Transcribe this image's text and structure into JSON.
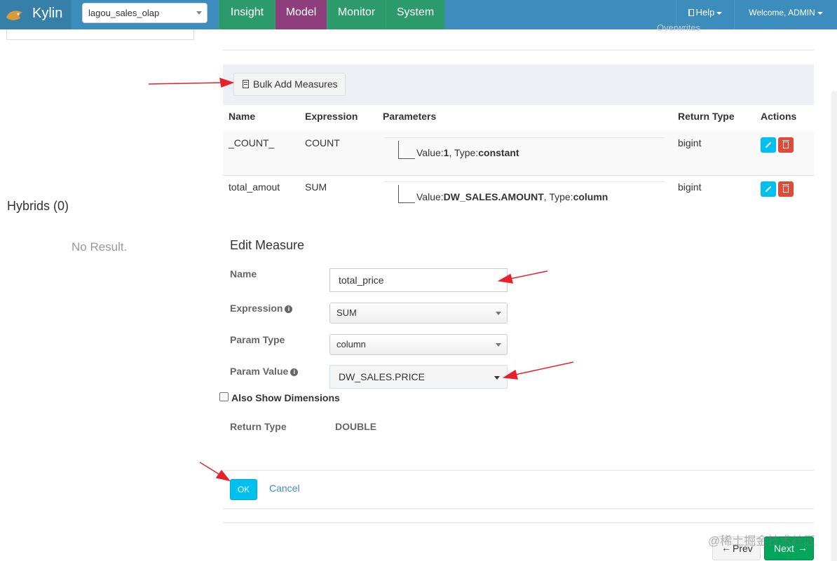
{
  "navbar": {
    "brand": "Kylin",
    "project": "lagou_sales_olap",
    "menu": [
      "Insight",
      "Model",
      "Monitor",
      "System"
    ],
    "active": "Model",
    "help": "Help",
    "welcome": "Welcome, ADMIN"
  },
  "left": {
    "hybrids_title": "Hybrids (0)",
    "no_result": "No Result."
  },
  "top_ghost_text": "Overwrites",
  "measures": {
    "bulk_add_label": "Bulk Add Measures",
    "columns": [
      "Name",
      "Expression",
      "Parameters",
      "Return Type",
      "Actions"
    ],
    "rows": [
      {
        "name": "_COUNT_",
        "expression": "COUNT",
        "param_value": "1",
        "param_type": "constant",
        "return_type": "bigint"
      },
      {
        "name": "total_amout",
        "expression": "SUM",
        "param_value": "DW_SALES.AMOUNT",
        "param_type": "column",
        "return_type": "bigint"
      }
    ],
    "value_prefix": "Value:",
    "type_prefix": ", Type:"
  },
  "edit": {
    "title": "Edit Measure",
    "name_label": "Name",
    "name_value": "total_price",
    "expression_label": "Expression",
    "expression_value": "SUM",
    "param_type_label": "Param Type",
    "param_type_value": "column",
    "param_value_label": "Param Value",
    "param_value_value": "DW_SALES.PRICE",
    "also_show_label": "Also Show Dimensions",
    "return_type_label": "Return Type",
    "return_type_value": "DOUBLE",
    "ok_label": "OK",
    "cancel_label": "Cancel"
  },
  "wizard": {
    "prev_label": "Prev",
    "next_label": "Next"
  },
  "watermark": "@稀土掘金技术社区",
  "colors": {
    "navbar": "#3c8dbc",
    "nav_item": "#2c9a6b",
    "nav_active": "#8e3e7b",
    "info": "#00c0ef",
    "danger": "#dd4b39",
    "success": "#00a65a",
    "annotation_arrow": "#e8202a"
  }
}
